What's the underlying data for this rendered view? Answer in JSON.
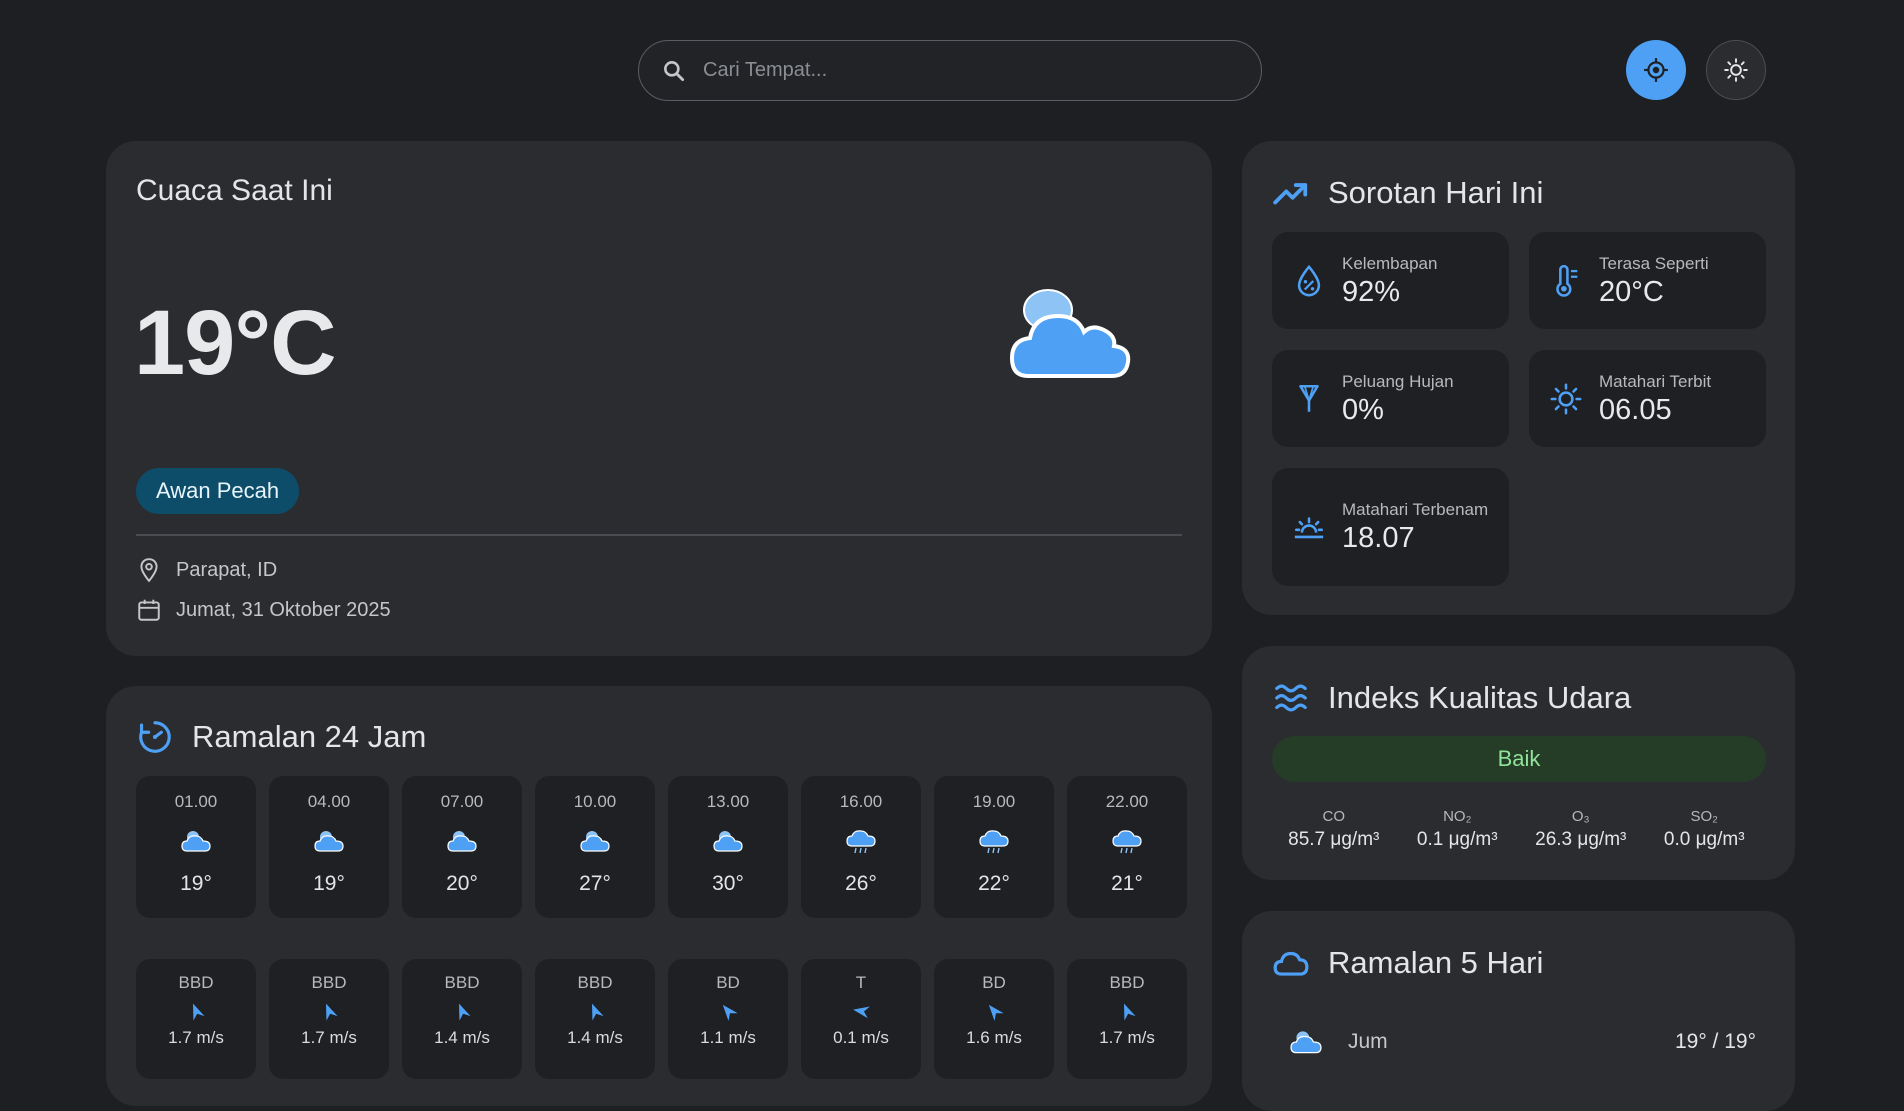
{
  "search": {
    "placeholder": "Cari Tempat..."
  },
  "icons": {
    "search": "search-icon",
    "locate": "crosshair-icon",
    "theme": "sun-icon"
  },
  "colors": {
    "accent": "#4ea0f5",
    "background": "#1e1f22",
    "card": "#2a2c30",
    "tile": "#1f2023",
    "description_pill": "#0e4d6a",
    "aqi_good_bg": "#253c27",
    "aqi_good_text": "#8fe39b"
  },
  "current": {
    "title": "Cuaca Saat Ini",
    "temperature": "19°C",
    "icon": "broken-clouds-icon",
    "description": "Awan Pecah",
    "location": "Parapat, ID",
    "date": "Jumat, 31 Oktober 2025"
  },
  "hourly": {
    "title": "Ramalan 24 Jam",
    "hours": [
      {
        "time": "01.00",
        "temp": "19°",
        "icon": "cloud-icon"
      },
      {
        "time": "04.00",
        "temp": "19°",
        "icon": "cloud-icon"
      },
      {
        "time": "07.00",
        "temp": "20°",
        "icon": "cloud-icon"
      },
      {
        "time": "10.00",
        "temp": "27°",
        "icon": "cloud-icon"
      },
      {
        "time": "13.00",
        "temp": "30°",
        "icon": "cloud-icon"
      },
      {
        "time": "16.00",
        "temp": "26°",
        "icon": "rain-cloud-icon"
      },
      {
        "time": "19.00",
        "temp": "22°",
        "icon": "rain-cloud-icon"
      },
      {
        "time": "22.00",
        "temp": "21°",
        "icon": "rain-cloud-icon"
      }
    ],
    "wind": [
      {
        "dir": "BBD",
        "speed": "1.7 m/s"
      },
      {
        "dir": "BBD",
        "speed": "1.7 m/s"
      },
      {
        "dir": "BBD",
        "speed": "1.4 m/s"
      },
      {
        "dir": "BBD",
        "speed": "1.4 m/s"
      },
      {
        "dir": "BD",
        "speed": "1.1 m/s"
      },
      {
        "dir": "T",
        "speed": "0.1 m/s"
      },
      {
        "dir": "BD",
        "speed": "1.6 m/s"
      },
      {
        "dir": "BBD",
        "speed": "1.7 m/s"
      }
    ]
  },
  "highlights": {
    "title": "Sorotan Hari Ini",
    "items": [
      {
        "label": "Kelembapan",
        "value": "92%",
        "icon": "humidity-icon"
      },
      {
        "label": "Terasa Seperti",
        "value": "20°C",
        "icon": "thermometer-icon"
      },
      {
        "label": "Peluang Hujan",
        "value": "0%",
        "icon": "umbrella-icon"
      },
      {
        "label": "Matahari Terbit",
        "value": "06.05",
        "icon": "sunrise-icon"
      },
      {
        "label": "Matahari Terbenam",
        "value": "18.07",
        "icon": "sunset-icon"
      }
    ]
  },
  "aqi": {
    "title": "Indeks Kualitas Udara",
    "status": "Baik",
    "pollutants": [
      {
        "name": "CO",
        "value": "85.7 μg/m³"
      },
      {
        "name": "NO₂",
        "value": "0.1 μg/m³"
      },
      {
        "name": "O₃",
        "value": "26.3 μg/m³"
      },
      {
        "name": "SO₂",
        "value": "0.0 μg/m³"
      }
    ]
  },
  "forecast5": {
    "title": "Ramalan 5 Hari",
    "days": [
      {
        "day": "Jum",
        "temp": "19° / 19°",
        "icon": "cloud-icon"
      }
    ]
  }
}
